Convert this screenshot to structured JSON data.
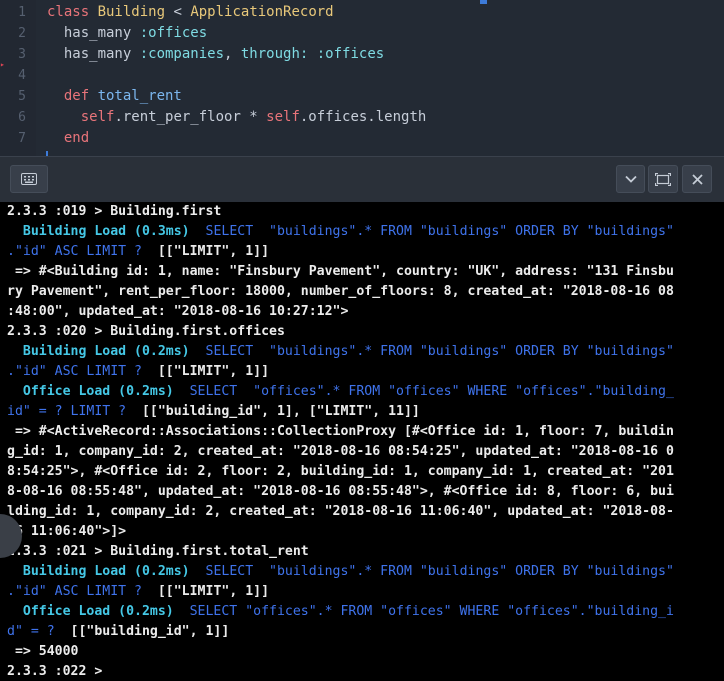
{
  "editor": {
    "line_numbers": [
      "1",
      "2",
      "3",
      "4",
      "5",
      "6",
      "7"
    ],
    "lines": [
      [
        {
          "t": "class ",
          "c": "kw"
        },
        {
          "t": "Building",
          "c": "cls"
        },
        {
          "t": " < ",
          "c": "plain"
        },
        {
          "t": "ApplicationRecord",
          "c": "cls"
        }
      ],
      [
        {
          "t": "  has_many ",
          "c": "plain"
        },
        {
          "t": ":offices",
          "c": "sym"
        }
      ],
      [
        {
          "t": "  has_many ",
          "c": "plain"
        },
        {
          "t": ":companies",
          "c": "sym"
        },
        {
          "t": ", ",
          "c": "plain"
        },
        {
          "t": "through:",
          "c": "sym"
        },
        {
          "t": " ",
          "c": "plain"
        },
        {
          "t": ":offices",
          "c": "sym"
        }
      ],
      [],
      [
        {
          "t": "  def ",
          "c": "kw"
        },
        {
          "t": "total_rent",
          "c": "fn"
        }
      ],
      [
        {
          "t": "    self",
          "c": "slf"
        },
        {
          "t": ".rent_per_floor * ",
          "c": "plain"
        },
        {
          "t": "self",
          "c": "slf"
        },
        {
          "t": ".offices.length",
          "c": "plain"
        }
      ],
      [
        {
          "t": "  end",
          "c": "kw"
        }
      ]
    ]
  },
  "toolbar": {
    "keyboard_icon": "keyboard-icon",
    "chevron_icon": "chevron-down-icon",
    "maximize_icon": "maximize-icon",
    "close_icon": "close-icon"
  },
  "terminal": {
    "lines": [
      [
        {
          "t": "2.3.3 :019 > Building.first",
          "c": ""
        }
      ],
      [
        {
          "t": "  Building Load (0.3ms)",
          "c": "cy"
        },
        {
          "t": "  SELECT  \"buildings\".* FROM \"buildings\" ORDER BY \"buildings\"",
          "c": "bl"
        }
      ],
      [
        {
          "t": ".\"id\" ASC LIMIT ?",
          "c": "bl"
        },
        {
          "t": "  [[\"LIMIT\", 1]]",
          "c": ""
        }
      ],
      [
        {
          "t": " => #<Building id: 1, name: \"Finsbury Pavement\", country: \"UK\", address: \"131 Finsbu",
          "c": ""
        }
      ],
      [
        {
          "t": "ry Pavement\", rent_per_floor: 18000, number_of_floors: 8, created_at: \"2018-08-16 08",
          "c": ""
        }
      ],
      [
        {
          "t": ":48:00\", updated_at: \"2018-08-16 10:27:12\">",
          "c": ""
        }
      ],
      [
        {
          "t": "2.3.3 :020 > Building.first.offices",
          "c": ""
        }
      ],
      [
        {
          "t": "  Building Load (0.2ms)",
          "c": "cy"
        },
        {
          "t": "  SELECT  \"buildings\".* FROM \"buildings\" ORDER BY \"buildings\"",
          "c": "bl"
        }
      ],
      [
        {
          "t": ".\"id\" ASC LIMIT ?",
          "c": "bl"
        },
        {
          "t": "  [[\"LIMIT\", 1]]",
          "c": ""
        }
      ],
      [
        {
          "t": "  Office Load (0.2ms)",
          "c": "cy"
        },
        {
          "t": "  SELECT  \"offices\".* FROM \"offices\" WHERE \"offices\".\"building_",
          "c": "bl"
        }
      ],
      [
        {
          "t": "id\" = ? LIMIT ?",
          "c": "bl"
        },
        {
          "t": "  [[\"building_id\", 1], [\"LIMIT\", 11]]",
          "c": ""
        }
      ],
      [
        {
          "t": " => #<ActiveRecord::Associations::CollectionProxy [#<Office id: 1, floor: 7, buildin",
          "c": ""
        }
      ],
      [
        {
          "t": "g_id: 1, company_id: 2, created_at: \"2018-08-16 08:54:25\", updated_at: \"2018-08-16 0",
          "c": ""
        }
      ],
      [
        {
          "t": "8:54:25\">, #<Office id: 2, floor: 2, building_id: 1, company_id: 1, created_at: \"201",
          "c": ""
        }
      ],
      [
        {
          "t": "8-08-16 08:55:48\", updated_at: \"2018-08-16 08:55:48\">, #<Office id: 8, floor: 6, bui",
          "c": ""
        }
      ],
      [
        {
          "t": "lding_id: 1, company_id: 2, created_at: \"2018-08-16 11:06:40\", updated_at: \"2018-08-",
          "c": ""
        }
      ],
      [
        {
          "t": "16 11:06:40\">]>",
          "c": ""
        }
      ],
      [
        {
          "t": "2.3.3 :021 > Building.first.total_rent",
          "c": ""
        }
      ],
      [
        {
          "t": "  Building Load (0.2ms)",
          "c": "cy"
        },
        {
          "t": "  SELECT  \"buildings\".* FROM \"buildings\" ORDER BY \"buildings\"",
          "c": "bl"
        }
      ],
      [
        {
          "t": ".\"id\" ASC LIMIT ?",
          "c": "bl"
        },
        {
          "t": "  [[\"LIMIT\", 1]]",
          "c": ""
        }
      ],
      [
        {
          "t": "  Office Load (0.2ms)",
          "c": "cy"
        },
        {
          "t": "  SELECT \"offices\".* FROM \"offices\" WHERE \"offices\".\"building_i",
          "c": "bl"
        }
      ],
      [
        {
          "t": "d\" = ?",
          "c": "bl"
        },
        {
          "t": "  [[\"building_id\", 1]]",
          "c": ""
        }
      ],
      [
        {
          "t": " => 54000",
          "c": ""
        }
      ],
      [
        {
          "t": "2.3.3 :022 > ",
          "c": ""
        }
      ]
    ]
  }
}
